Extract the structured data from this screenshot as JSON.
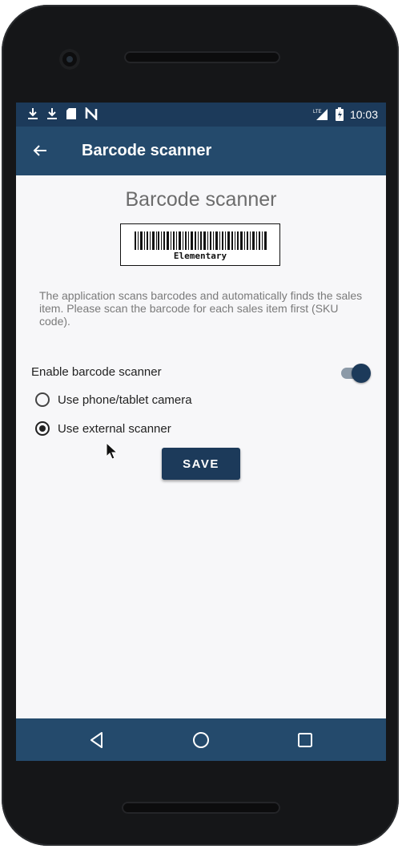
{
  "statusbar": {
    "time": "10:03",
    "left_icons": [
      "download-icon",
      "download-icon",
      "sd-card-icon",
      "nfc-icon"
    ],
    "right_icons": [
      "lte-signal-icon",
      "battery-icon"
    ]
  },
  "toolbar": {
    "title": "Barcode scanner",
    "back_icon": "arrow-back-icon"
  },
  "main": {
    "title": "Barcode scanner",
    "barcode_caption": "Elementary",
    "description": "The application scans barcodes and automatically finds the sales item. Please scan the barcode for each sales item first (SKU code).",
    "enable_label": "Enable barcode scanner",
    "enable_on": true,
    "options": [
      {
        "label": "Use phone/tablet camera",
        "selected": false
      },
      {
        "label": "Use external scanner",
        "selected": true
      }
    ],
    "save_label": "SAVE"
  },
  "navbar": {
    "icons": [
      "back-triangle-icon",
      "home-circle-icon",
      "recents-square-icon"
    ]
  },
  "colors": {
    "primary": "#244a6c",
    "primary_dark": "#1c3a5a",
    "background": "#f7f7f9"
  }
}
